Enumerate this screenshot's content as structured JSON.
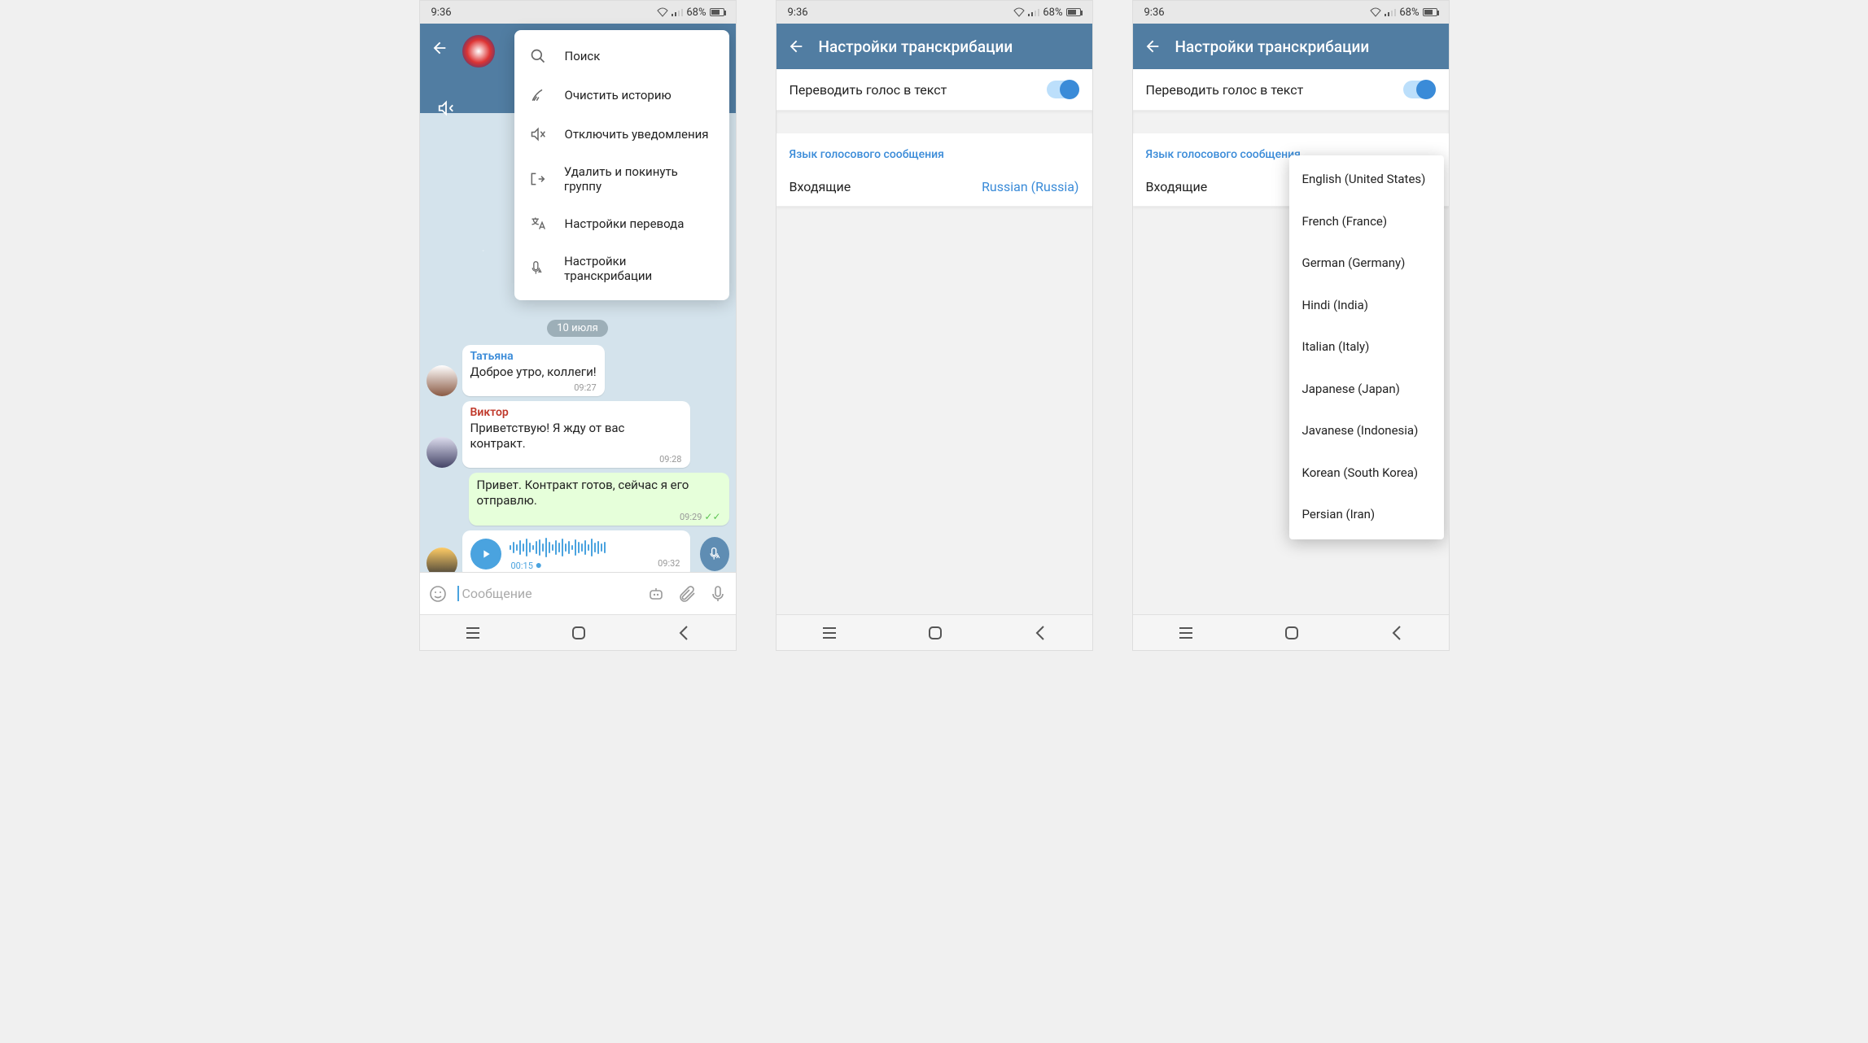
{
  "status": {
    "time": "9:36",
    "battery_text": "68%"
  },
  "screen1": {
    "menu": [
      {
        "icon": "search-icon",
        "label": "Поиск"
      },
      {
        "icon": "broom-icon",
        "label": "Очистить историю"
      },
      {
        "icon": "mute-icon",
        "label": "Отключить уведомления"
      },
      {
        "icon": "leave-icon",
        "label": "Удалить и покинуть группу"
      },
      {
        "icon": "translate-icon",
        "label": "Настройки перевода"
      },
      {
        "icon": "mic-aa-icon",
        "label": "Настройки транскрибации"
      }
    ],
    "date_label": "10 июля",
    "messages": {
      "m1": {
        "sender": "Татьяна",
        "sender_color": "#3a8bd8",
        "text": "Доброе утро, коллеги!",
        "time": "09:27"
      },
      "m2": {
        "sender": "Виктор",
        "sender_color": "#c0392b",
        "text": "Приветствую! Я жду от вас контракт.",
        "time": "09:28"
      },
      "m3": {
        "text": "Привет. Контракт готов, сейчас я его отправлю.",
        "time": "09:29"
      },
      "voice": {
        "duration": "00:15",
        "time": "09:32"
      }
    },
    "input_placeholder": "Сообщение"
  },
  "screen2": {
    "title": "Настройки транскрибации",
    "toggle_label": "Переводить голос в текст",
    "section": "Язык голосового сообщения",
    "incoming_label": "Входящие",
    "incoming_value": "Russian (Russia)"
  },
  "screen3": {
    "title": "Настройки транскрибации",
    "toggle_label": "Переводить голос в текст",
    "section": "Язык голосового сообщения",
    "incoming_label": "Входящие",
    "languages": [
      "English (United States)",
      "French (France)",
      "German (Germany)",
      "Hindi (India)",
      "Italian (Italy)",
      "Japanese (Japan)",
      "Javanese (Indonesia)",
      "Korean (South Korea)",
      "Persian (Iran)"
    ]
  }
}
